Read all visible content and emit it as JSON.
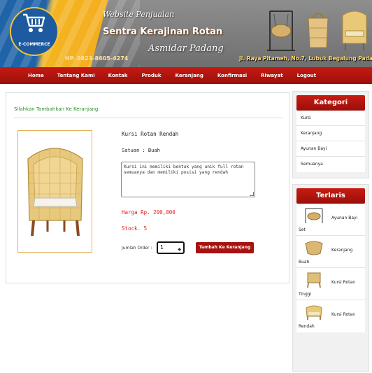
{
  "header": {
    "logo_text": "E-COMMERCE",
    "website_label": "Website Penjualan",
    "title": "Sentra Kerajinan Rotan",
    "subtitle": "Asmidar Padang",
    "phone": "HP. 0823-8605-4274",
    "address": "Jl. Raya Pitameh, No.7, Lubuk Begalung Padang"
  },
  "nav": {
    "items": [
      "Home",
      "Tentang Kami",
      "Kontak",
      "Produk",
      "Keranjang",
      "Konfirmasi",
      "Riwayat",
      "Logout"
    ]
  },
  "main": {
    "heading": "Silahkan Tambahkan Ke Keranjang",
    "product_name": "Kursi Rotan Rendah",
    "unit": "Satuan : Buah",
    "description": "Kursi ini memiliki bentuk yang unik full rotan semuanya dan memiliki posisi yang rendah",
    "price": "Harga Rp. 200,000",
    "stock": "Stock. 5",
    "qty_label": "Jumlah Order :",
    "qty_value": "1",
    "add_button": "Tambah Ke Keranjang"
  },
  "sidebar": {
    "category_title": "Kategori",
    "categories": [
      "Kursi",
      "Keranjang",
      "Ayunan Bayi",
      "Semuanya"
    ],
    "best_title": "Terlaris",
    "best": [
      {
        "name": "Ayunan Bayi",
        "cont": "Set"
      },
      {
        "name": "Keranjang",
        "cont": "Buah"
      },
      {
        "name": "Kursi Rotan",
        "cont": "Tinggi"
      },
      {
        "name": "Kursi Rotan",
        "cont": "Rendah"
      }
    ]
  },
  "colors": {
    "nav_red": "#a7120e",
    "green_heading": "#2b8a2b",
    "price_red": "#e02020"
  }
}
